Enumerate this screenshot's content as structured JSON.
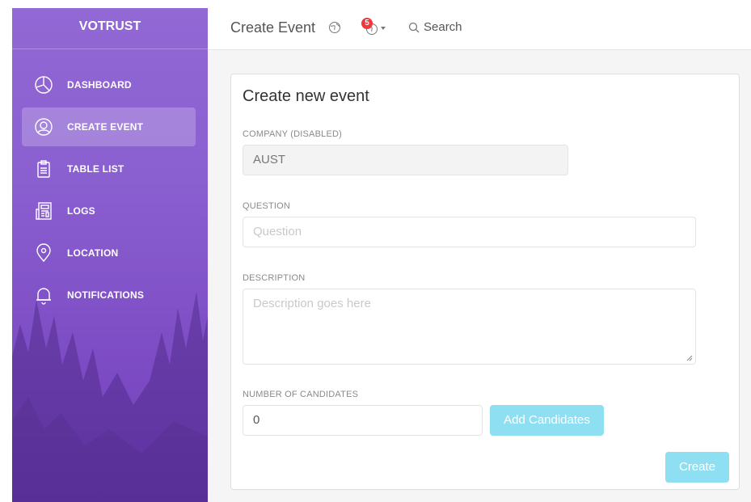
{
  "sidebar": {
    "brand": "VOTRUST",
    "items": [
      {
        "label": "DASHBOARD",
        "icon": "pie-chart-icon",
        "active": false
      },
      {
        "label": "CREATE EVENT",
        "icon": "user-circle-icon",
        "active": true
      },
      {
        "label": "TABLE LIST",
        "icon": "clipboard-icon",
        "active": false
      },
      {
        "label": "LOGS",
        "icon": "news-icon",
        "active": false
      },
      {
        "label": "LOCATION",
        "icon": "map-pin-icon",
        "active": false
      },
      {
        "label": "NOTIFICATIONS",
        "icon": "bell-icon",
        "active": false
      }
    ]
  },
  "topbar": {
    "title": "Create Event",
    "notification_count": "5",
    "search_label": "Search"
  },
  "form": {
    "title": "Create new event",
    "company_label": "COMPANY (DISABLED)",
    "company_value": "AUST",
    "question_label": "QUESTION",
    "question_placeholder": "Question",
    "description_label": "DESCRIPTION",
    "description_placeholder": "Description goes here",
    "candidates_label": "NUMBER OF CANDIDATES",
    "candidates_value": "0",
    "add_candidates_label": "Add Candidates",
    "create_label": "Create"
  },
  "colors": {
    "sidebar_top": "#9168d4",
    "sidebar_bottom": "#7240bd",
    "button": "#8fdff2",
    "badge": "#f0373c"
  }
}
